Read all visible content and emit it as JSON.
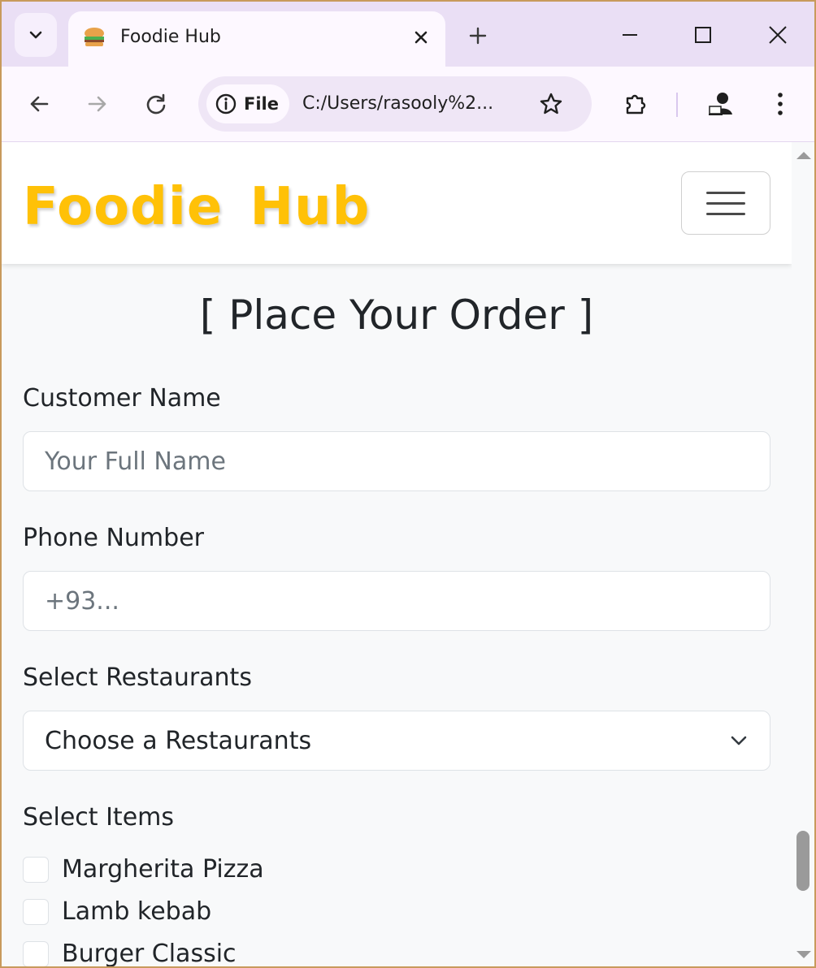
{
  "browser": {
    "tab_title": "Foodie Hub",
    "url_chip": "File",
    "url": "C:/Users/rasooly%2..."
  },
  "site": {
    "brand": "Foodie Hub",
    "brand_color": "#ffc107"
  },
  "form": {
    "title": "[ Place Your Order ]",
    "customer_name": {
      "label": "Customer Name",
      "placeholder": "Your Full Name"
    },
    "phone": {
      "label": "Phone Number",
      "placeholder": "+93..."
    },
    "restaurant": {
      "label": "Select Restaurants",
      "selected": "Choose a Restaurants"
    },
    "items_label": "Select Items",
    "items": [
      {
        "label": "Margherita Pizza",
        "checked": false
      },
      {
        "label": "Lamb kebab",
        "checked": false
      },
      {
        "label": "Burger Classic",
        "checked": false
      }
    ]
  }
}
